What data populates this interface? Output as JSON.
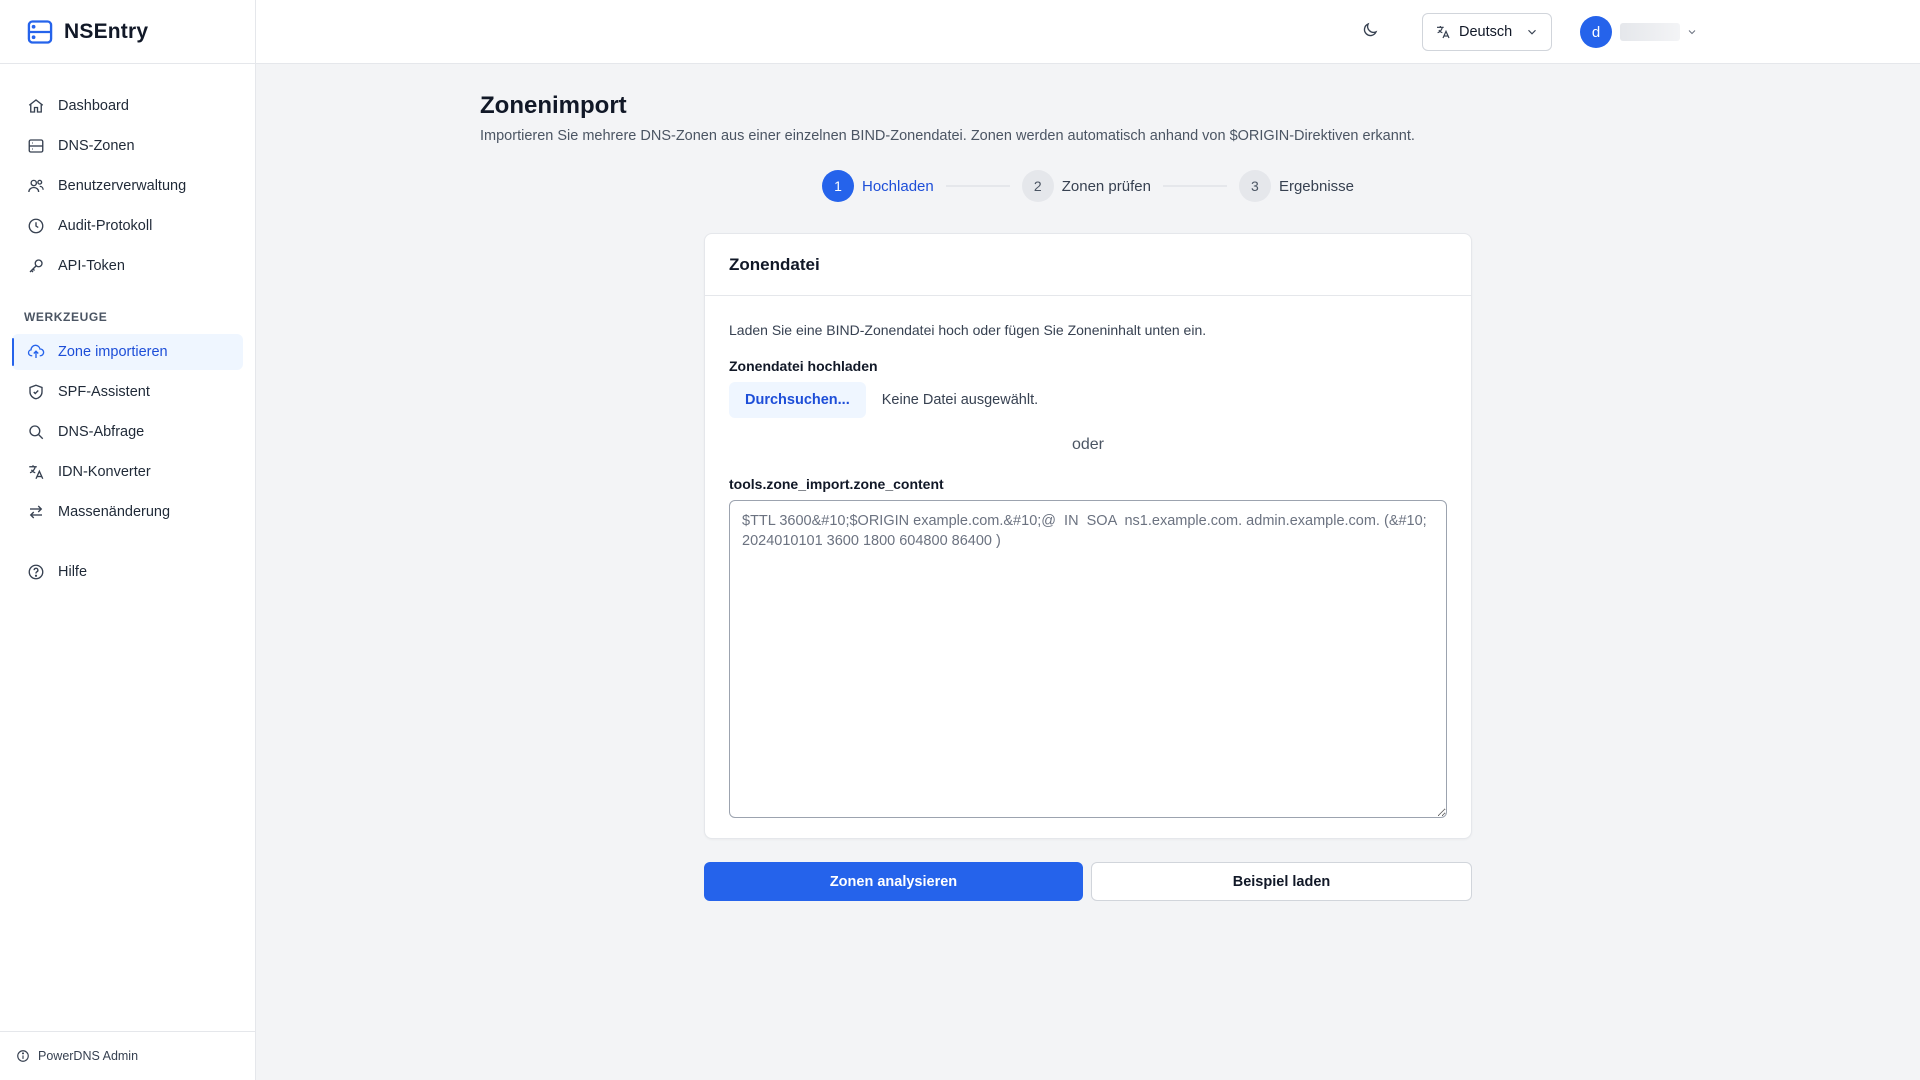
{
  "app": {
    "name": "NSEntry",
    "logo_icon": "server-stack-icon"
  },
  "sidebar": {
    "main_items": [
      {
        "label": "Dashboard",
        "icon": "home-icon"
      },
      {
        "label": "DNS-Zonen",
        "icon": "server-icon"
      },
      {
        "label": "Benutzerverwaltung",
        "icon": "users-icon"
      },
      {
        "label": "Audit-Protokoll",
        "icon": "clock-icon"
      },
      {
        "label": "API-Token",
        "icon": "key-icon"
      }
    ],
    "tools_label": "WERKZEUGE",
    "tool_items": [
      {
        "label": "Zone importieren",
        "icon": "cloud-upload-icon",
        "active": true
      },
      {
        "label": "SPF-Assistent",
        "icon": "shield-icon"
      },
      {
        "label": "DNS-Abfrage",
        "icon": "search-icon"
      },
      {
        "label": "IDN-Konverter",
        "icon": "language-icon"
      },
      {
        "label": "Massenänderung",
        "icon": "arrows-swap-icon"
      }
    ],
    "help_item": {
      "label": "Hilfe",
      "icon": "question-circle-icon"
    },
    "footer": {
      "label": "PowerDNS Admin",
      "icon": "info-icon"
    }
  },
  "topbar": {
    "theme_icon": "moon-icon",
    "language": {
      "label": "Deutsch",
      "icon": "language-icon"
    },
    "user": {
      "initial": "d"
    }
  },
  "page": {
    "title": "Zonenimport",
    "description": "Importieren Sie mehrere DNS-Zonen aus einer einzelnen BIND-Zonendatei. Zonen werden automatisch anhand von $ORIGIN-Direktiven erkannt."
  },
  "stepper": {
    "steps": [
      {
        "number": "1",
        "label": "Hochladen",
        "active": true
      },
      {
        "number": "2",
        "label": "Zonen prüfen",
        "active": false
      },
      {
        "number": "3",
        "label": "Ergebnisse",
        "active": false
      }
    ]
  },
  "card": {
    "title": "Zonendatei",
    "hint": "Laden Sie eine BIND-Zonendatei hoch oder fügen Sie Zoneninhalt unten ein.",
    "upload_label": "Zonendatei hochladen",
    "browse_label": "Durchsuchen...",
    "file_status": "Keine Datei ausgewählt.",
    "or_text": "oder",
    "content_label": "tools.zone_import.zone_content",
    "content_placeholder": "$TTL 3600&#10;$ORIGIN example.com.&#10;@  IN  SOA  ns1.example.com. admin.example.com. (&#10; 2024010101 3600 1800 604800 86400 )",
    "content_value": ""
  },
  "actions": {
    "analyze_label": "Zonen analysieren",
    "example_label": "Beispiel laden"
  },
  "colors": {
    "primary": "#2563eb",
    "active_bg": "#eff6ff",
    "background": "#f3f4f6"
  }
}
